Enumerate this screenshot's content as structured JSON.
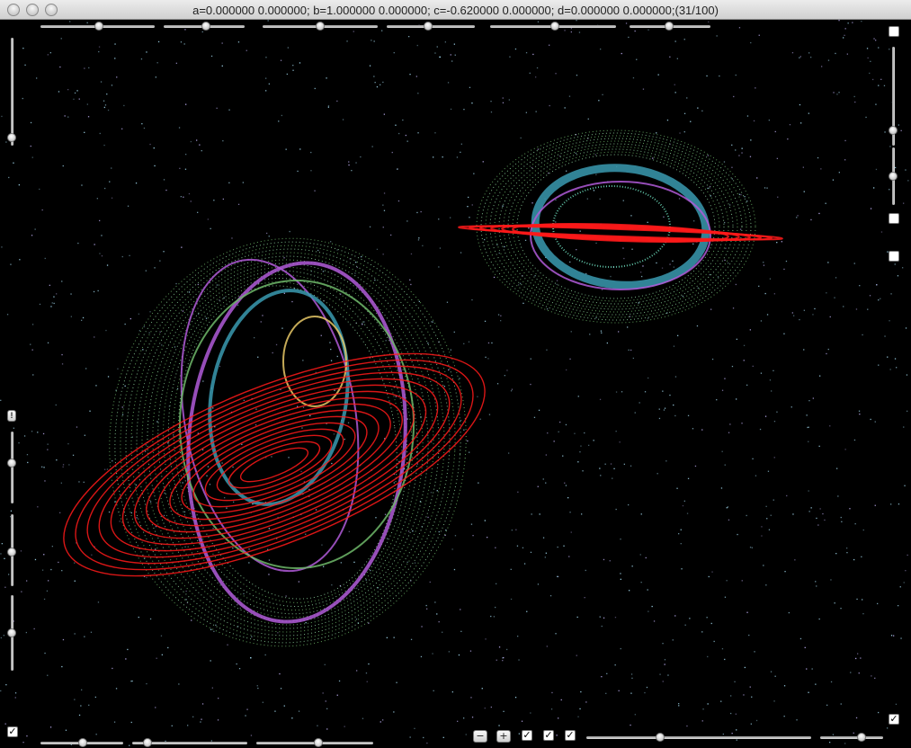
{
  "window": {
    "title": "a=0.000000 0.000000; b=1.000000 0.000000; c=-0.620000 0.000000; d=0.000000 0.000000;(31/100)"
  },
  "controls": {
    "top_sliders": [
      {
        "name": "top-slider-1",
        "value": 0.5
      },
      {
        "name": "top-slider-2",
        "value": 0.5
      },
      {
        "name": "top-slider-3",
        "value": 0.5
      },
      {
        "name": "top-slider-4",
        "value": 0.5
      },
      {
        "name": "top-slider-5",
        "value": 0.5
      },
      {
        "name": "top-slider-6",
        "value": 0.5
      }
    ],
    "bottom_buttons": {
      "minus": "−",
      "plus": "+"
    },
    "check_mark": "✓",
    "warn_label": "!",
    "checkbox_states": {
      "bottom_left": true,
      "bottom_mid_1": true,
      "bottom_mid_2": true,
      "bottom_mid_3": true,
      "bottom_right": true,
      "right_top": false,
      "right_mid_1": false,
      "right_mid_2": false
    }
  },
  "visual": {
    "background": "#000000",
    "colors": {
      "red_orbit": "#ff1a1a",
      "purple": "#b05ad8",
      "green": "#6fb86a",
      "teal": "#3a9ab0",
      "cyan_dust": "#aee8ff",
      "yellow": "#e8c866",
      "pink": "#d070e0"
    }
  }
}
